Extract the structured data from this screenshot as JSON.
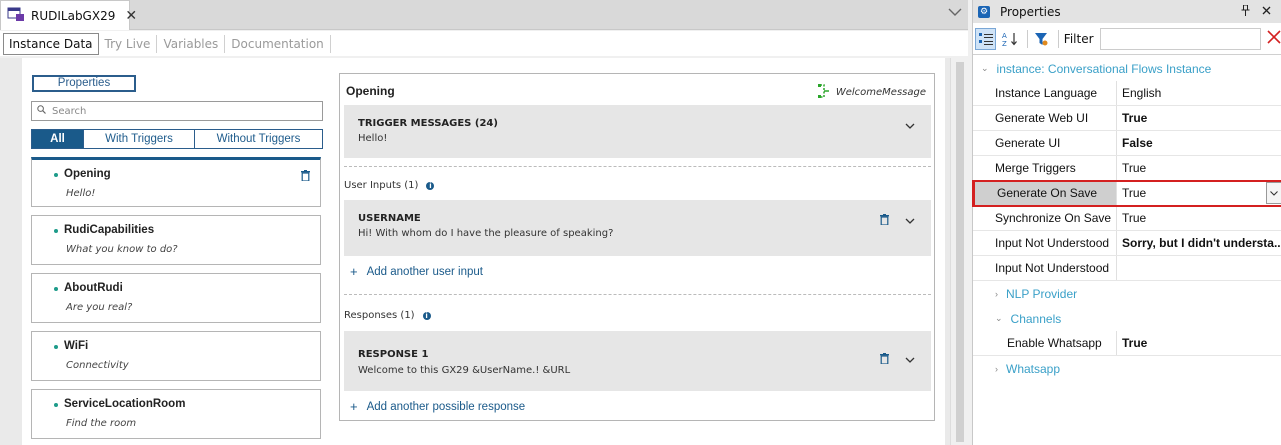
{
  "doc_tab": {
    "title": "RUDILabGX29",
    "close": "✕"
  },
  "sub_tabs": [
    "Instance Data",
    "Try Live",
    "Variables",
    "Documentation"
  ],
  "left": {
    "properties_button": "Properties",
    "search_placeholder": "Search",
    "filters": [
      "All",
      "With Triggers",
      "Without Triggers"
    ],
    "flows": [
      {
        "name": "Opening",
        "desc": "Hello!"
      },
      {
        "name": "RudiCapabilities",
        "desc": "What you know to do?"
      },
      {
        "name": "AboutRudi",
        "desc": "Are you real?"
      },
      {
        "name": "WiFi",
        "desc": "Connectivity"
      },
      {
        "name": "ServiceLocationRoom",
        "desc": "Find the room"
      }
    ]
  },
  "panel": {
    "title": "Opening",
    "welcome": "WelcomeMessage",
    "trigger": {
      "title": "TRIGGER MESSAGES (24)",
      "text": "Hello!"
    },
    "user_inputs_label": "User Inputs (1)",
    "username": {
      "title": "USERNAME",
      "text": "Hi! With whom do I have the pleasure of speaking?"
    },
    "add_user_input": "Add another user input",
    "responses_label": "Responses (1)",
    "response": {
      "title": "RESPONSE 1",
      "text": "Welcome to this GX29 &UserName.! &URL"
    },
    "add_response": "Add another possible response"
  },
  "properties": {
    "title": "Properties",
    "filter_label": "Filter",
    "category": "instance: Conversational Flows Instance",
    "rows": [
      {
        "name": "Instance Language",
        "value": "English",
        "bold": false
      },
      {
        "name": "Generate Web UI",
        "value": "True",
        "bold": true
      },
      {
        "name": "Generate UI",
        "value": "False",
        "bold": true
      },
      {
        "name": "Merge Triggers",
        "value": "True",
        "bold": false
      },
      {
        "name": "Generate On Save",
        "value": "True",
        "bold": false
      },
      {
        "name": "Synchronize On Save",
        "value": "True",
        "bold": false
      },
      {
        "name": "Input Not Understood",
        "value": "Sorry, but I didn't understa...",
        "bold": true
      },
      {
        "name": "Input Not Understood",
        "value": "",
        "bold": false
      }
    ],
    "nlp_provider": "NLP Provider",
    "channels": "Channels",
    "enable_whatsapp": {
      "name": "Enable Whatsapp",
      "value": "True"
    },
    "whatsapp": "Whatsapp"
  },
  "colors": {
    "accent": "#1a5a8a",
    "category": "#3aa0c8",
    "highlight": "#d42020",
    "teal_dot": "#1d9b8a"
  }
}
